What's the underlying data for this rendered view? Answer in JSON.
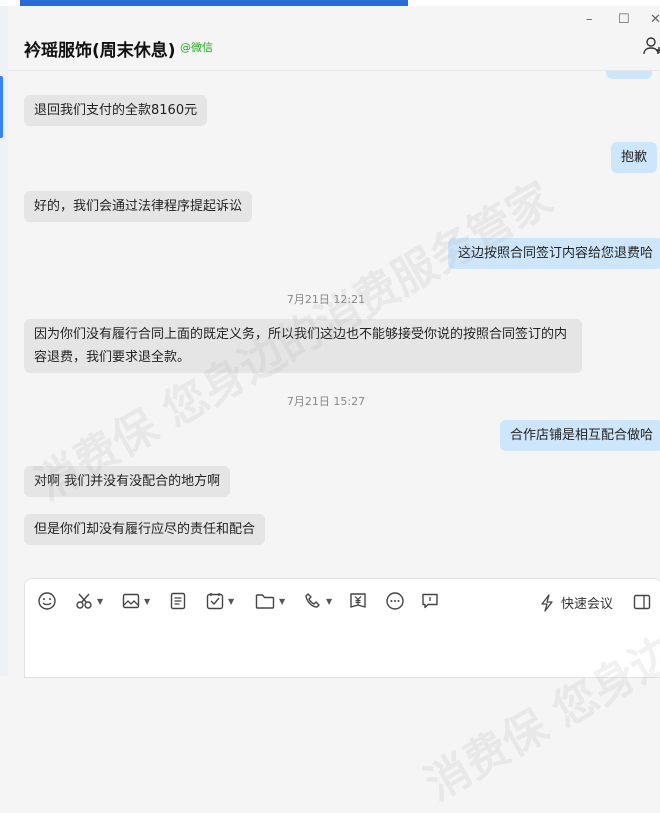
{
  "window": {
    "title": "衿瑶服饰(周末休息)",
    "source_tag": "@微信",
    "controls": {
      "minimize": "–",
      "maximize": "☐",
      "close": "✕"
    }
  },
  "messages": [
    {
      "side": "in",
      "text": "退回我们支付的全款8160元"
    },
    {
      "side": "out",
      "text": "抱歉"
    },
    {
      "side": "in",
      "text": "好的，我们会通过法律程序提起诉讼"
    },
    {
      "side": "out",
      "text": "这边按照合同签订内容给您退费哈"
    },
    {
      "time": "7月21日 12:21"
    },
    {
      "side": "in",
      "text_line1": "因为你们没有履行合同上面的既定义务，所以我们这边也不能够接受你说的按照合同签订的内",
      "text_line2": "容退费，我们要求退全款。"
    },
    {
      "time": "7月21日 15:27"
    },
    {
      "side": "out",
      "text": "合作店铺是相互配合做哈"
    },
    {
      "side": "in",
      "text": "对啊 我们并没有没配合的地方啊"
    },
    {
      "side": "in",
      "text": "但是你们却没有履行应尽的责任和配合"
    }
  ],
  "toolbar": {
    "icons": [
      "emoji-icon",
      "scissors-icon",
      "image-icon",
      "document-icon",
      "checklist-icon",
      "folder-icon",
      "phone-icon",
      "payment-icon",
      "more-icon",
      "chat-record-icon"
    ],
    "quick_meeting_label": "快速会议"
  },
  "watermark": "消费保 您身边的消费服务管家",
  "colors": {
    "incoming": "#e5e5e5",
    "outgoing": "#cde6fb",
    "wechat": "#1aad19",
    "accent": "#3b82f6"
  }
}
